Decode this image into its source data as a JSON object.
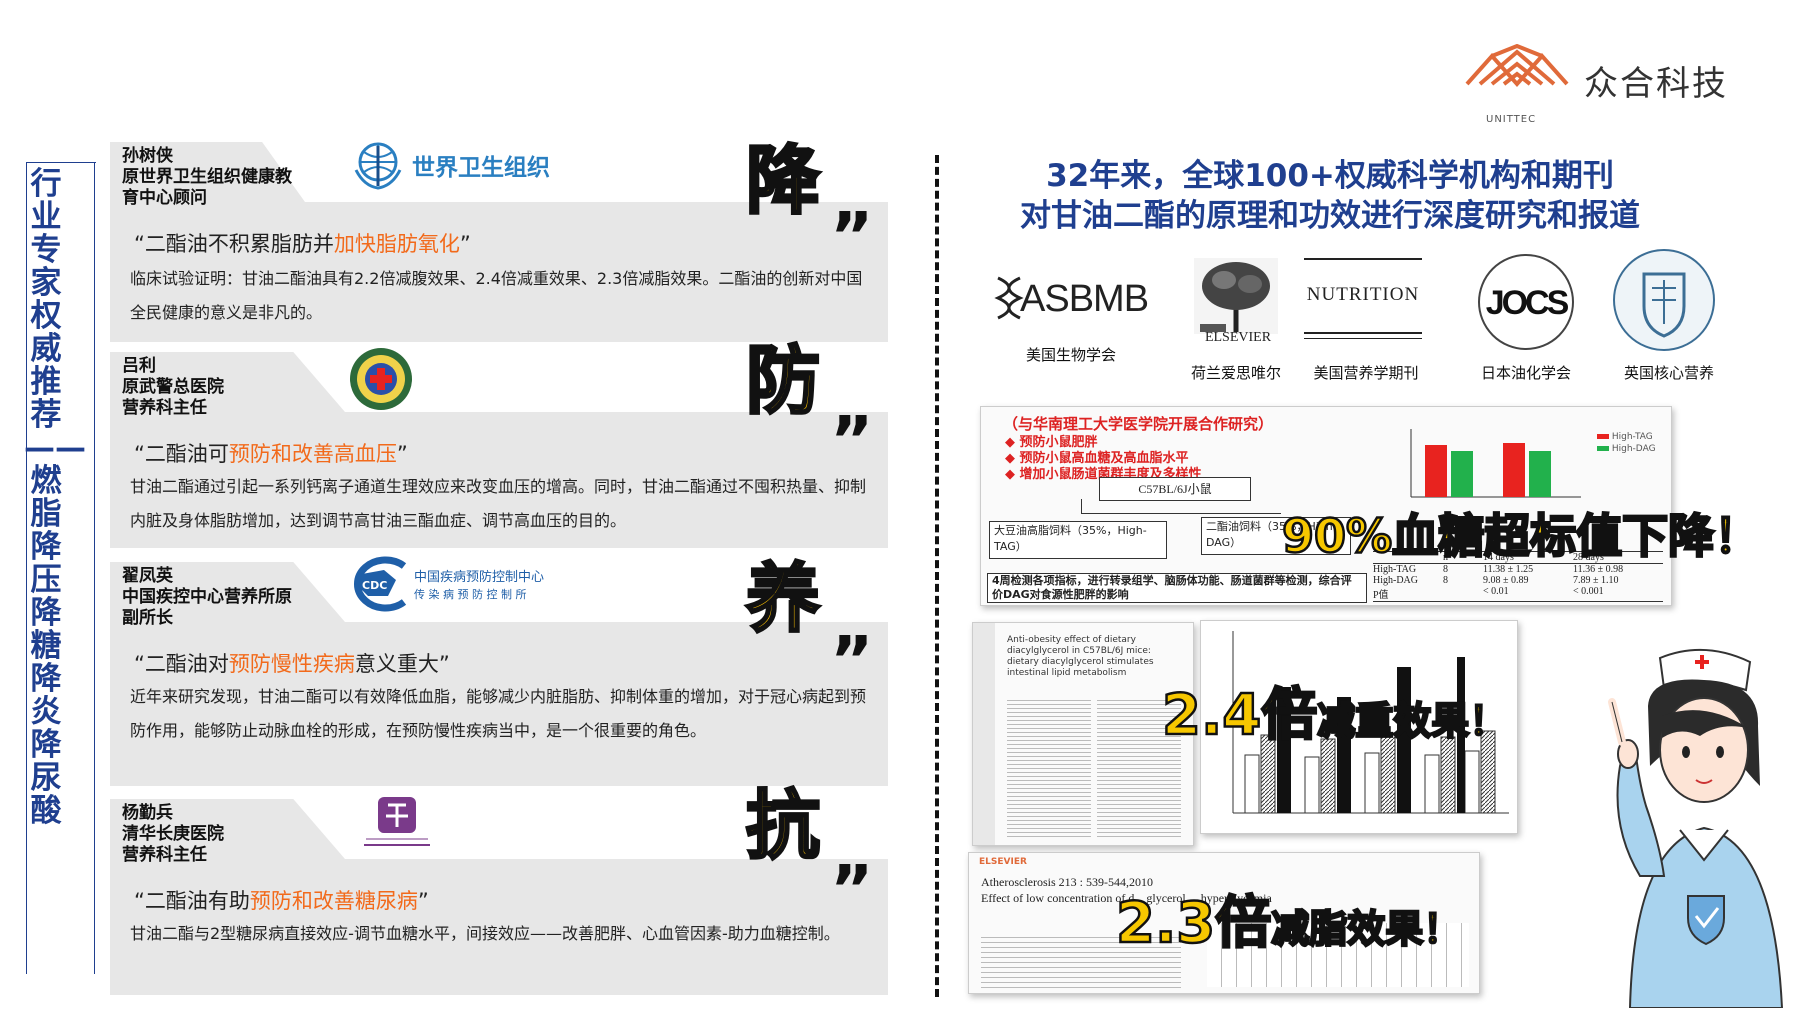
{
  "brand": {
    "name": "众合科技",
    "sub": "UNITTEC",
    "color": "#e06a3a"
  },
  "left_title": "行业专家权威推荐——燃脂 降压 降糖 降炎 降尿酸",
  "experts": [
    {
      "name": "孙树侠",
      "title1": "原世界卫生组织健康教",
      "title2": "育中心顾问",
      "org_logo_text": "世界卫生组织",
      "big_char": "降",
      "quote_pre": "“二酯油不积累脂肪并",
      "quote_hl": "加快脂肪氧化",
      "quote_post": "”",
      "body": "临床试验证明：甘油二酯油具有2.2倍减腹效果、2.4倍减重效果、2.3倍减脂效果。二酯油的创新对中国全民健康的意义是非凡的。"
    },
    {
      "name": "吕利",
      "title1": "原武警总医院",
      "title2": "营养科主任",
      "org_logo_text": "",
      "big_char": "防",
      "quote_pre": "“二酯油可",
      "quote_hl": "预防和改善高血压",
      "quote_post": "”",
      "body": "甘油二酯通过引起一系列钙离子通道生理效应来改变血压的增高。同时，甘油二酯通过不囤积热量、抑制内脏及身体脂肪增加，达到调节高甘油三酯血症、调节高血压的目的。"
    },
    {
      "name": "翟凤英",
      "title1": "中国疾控中心营养所原",
      "title2": "副所长",
      "org_logo_text": "中国疾病预防控制中心",
      "org_logo_sub": "传 染 病 预 防 控 制 所",
      "big_char": "养",
      "quote_pre": "“二酯油对",
      "quote_hl": "预防慢性疾病",
      "quote_post": "意义重大”",
      "body": "近年来研究发现，甘油二酯可以有效降低血脂，能够减少内脏脂肪、抑制体重的增加，对于冠心病起到预防作用，能够防止动脉血栓的形成，在预防慢性疾病当中，是一个很重要的角色。"
    },
    {
      "name": "杨勤兵",
      "title1": "清华长庚医院",
      "title2": "营养科主任",
      "org_logo_text": "",
      "big_char": "抗",
      "quote_pre": "“二酯油有助",
      "quote_hl": "预防和改善糖尿病",
      "quote_post": "”",
      "body": "甘油二酯与2型糖尿病直接效应-调节血糖水平，间接效应——改善肥胖、心血管因素-助力血糖控制。"
    }
  ],
  "right_title_1": "32年来，全球100+权威科学机构和期刊",
  "right_title_2": "对甘油二酯的原理和功效进行深度研究和报道",
  "publishers": [
    {
      "logo": "ASBMB",
      "label": "美国生物学会"
    },
    {
      "logo": "ELSEVIER",
      "label": "荷兰爱思唯尔"
    },
    {
      "logo": "NUTRITION",
      "label": "美国营养学期刊"
    },
    {
      "logo": "JOCS",
      "label": "日本油化学会"
    },
    {
      "logo": "",
      "label": "英国核心营养"
    }
  ],
  "study1": {
    "heading": "（与华南理工大学医学院开展合作研究）",
    "bullets": [
      "预防小鼠肥胖",
      "预防小鼠高血糖及高血脂水平",
      "增加小鼠肠道菌群丰度及多样性"
    ],
    "mouse": "C57BL/6J小鼠",
    "left_box": "大豆油高脂饲料（35%，High-TAG）",
    "right_box": "二酯油饲料（35%，High-DAG）",
    "bottom_box": "4周检测各项指标，进行转录组学、脑肠体功能、肠道菌群等检测，综合评价DAG对食源性肥胖的影响",
    "legend": [
      "High-TAG",
      "High-DAG"
    ],
    "table_head": [
      "n",
      "14 days",
      "28 days"
    ],
    "table_rows": [
      [
        "High-TAG",
        "8",
        "11.38 ± 1.25",
        "11.36 ± 0.98"
      ],
      [
        "High-DAG",
        "8",
        "9.08 ± 0.89",
        "7.89 ± 1.10"
      ],
      [
        "P值",
        "",
        "< 0.01",
        "< 0.001"
      ]
    ],
    "overlay": "90%血糖超标值下降！"
  },
  "study2": {
    "title": "Anti-obesity effect of dietary diacylglycerol in C57BL/6J mice: dietary diacylglycerol stimulates intestinal lipid metabolism",
    "overlay_num": "2.4倍",
    "overlay_text": "减重效果！"
  },
  "study3": {
    "journal": "Atherosclerosis 213 : 539-544,2010",
    "title": "Effect of low concentration of d... glycerol ... hyperglycemia",
    "overlay_num": "2.3倍",
    "overlay_text": "减脂效果！"
  },
  "colors": {
    "accent_blue": "#1f3f8f",
    "highlight": "#f26a1b",
    "yellow": "#ffc400",
    "card_bg": "#e7e7e7",
    "red_bar": "#e8231f",
    "green_bar": "#22b14c"
  }
}
